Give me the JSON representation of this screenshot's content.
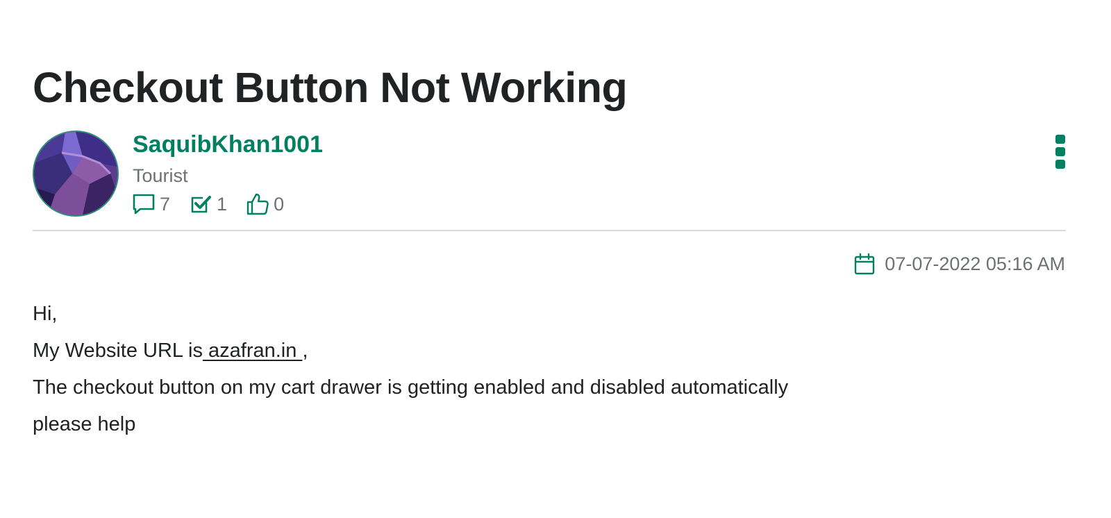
{
  "post": {
    "title": "Checkout Button Not Working",
    "author": {
      "name": "SaquibKhan1001",
      "rank": "Tourist",
      "stats": {
        "messages": "7",
        "solutions": "1",
        "kudos": "0"
      }
    },
    "date": "07-07-2022 05:16 AM",
    "body": {
      "line1": "Hi,",
      "line2_prefix": "My Website URL is",
      "link_text": " azafran.in ",
      "line2_suffix": ",",
      "line3": "The checkout button on my cart drawer is getting enabled and disabled automatically",
      "line4": "please help"
    }
  },
  "colors": {
    "brand_green": "#008060",
    "text_dark": "#202223",
    "text_subdued": "#6d7175",
    "divider": "#dadbdd"
  },
  "icons": {
    "messages": "speech-bubble-icon",
    "solutions": "check-box-icon",
    "kudos": "thumbs-up-icon",
    "date": "calendar-icon",
    "menu": "kebab-menu-icon"
  }
}
